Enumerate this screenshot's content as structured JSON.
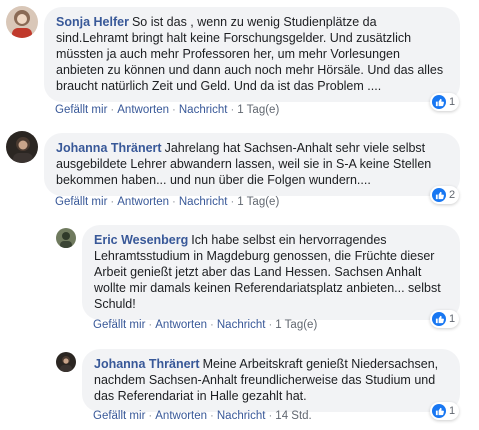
{
  "labels": {
    "like": "Gefällt mir",
    "reply": "Antworten",
    "message": "Nachricht",
    "dot": "·"
  },
  "colors": {
    "author": "#385898",
    "bubble": "#f2f3f5",
    "like": "#1877f2"
  },
  "comments": [
    {
      "author": "Sonja Helfer",
      "text": "So ist das , wenn zu wenig Studienplätze da sind.Lehramt bringt halt keine Forschungsgelder. Und zusätzlich müssten ja auch mehr Professoren her, um mehr Vorlesungen anbieten zu können und dann auch noch mehr Hörsäle. Und das alles braucht natürlich Zeit und Geld. Und da ist das Problem ....",
      "time": "1 Tag(e)",
      "reactions": "1",
      "avatar_icon": "user-avatar-icon"
    },
    {
      "author": "Johanna Thränert",
      "text": "Jahrelang hat Sachsen-Anhalt sehr viele selbst ausgebildete Lehrer abwandern lassen, weil sie in S-A keine Stellen bekommen haben... und nun über die Folgen wundern....",
      "time": "1 Tag(e)",
      "reactions": "2",
      "avatar_icon": "user-avatar-icon"
    },
    {
      "author": "Eric Wesenberg",
      "text": "Ich habe selbst ein hervorragendes Lehramtsstudium in Magdeburg genossen, die Früchte dieser Arbeit genießt jetzt aber das Land Hessen. Sachsen Anhalt wollte mir damals keinen Referendariatsplatz anbieten... selbst Schuld!",
      "time": "1 Tag(e)",
      "reactions": "1",
      "avatar_icon": "user-avatar-icon"
    },
    {
      "author": "Johanna Thränert",
      "text": "Meine Arbeitskraft genießt Niedersachsen, nachdem Sachsen-Anhalt freundlicherweise das Studium und das Referendariat in Halle gezahlt hat.",
      "time": "14 Std.",
      "reactions": "1",
      "avatar_icon": "user-avatar-icon"
    }
  ]
}
